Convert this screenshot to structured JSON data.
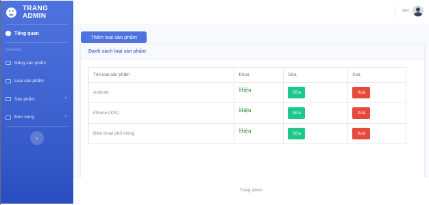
{
  "sidebar": {
    "brand": "TRANG ADMIN",
    "dashboard_label": "Tổng quan",
    "section_heading": "DANH MỤC",
    "items": [
      {
        "label": "Hãng sản phẩm"
      },
      {
        "label": "Loại sản phẩm"
      },
      {
        "label": "Sản phẩm",
        "chevron": "›"
      },
      {
        "label": "Đơn hàng",
        "chevron": "›"
      }
    ],
    "toggle_glyph": "‹"
  },
  "topbar": {
    "user_name": "viet"
  },
  "main": {
    "add_button": "Thêm loại sản phẩm",
    "card_title": "Danh sách loại sản phẩm",
    "table": {
      "headers": [
        "Tên loại sản phẩm",
        "Khoá",
        "Sửa",
        "Xoá"
      ],
      "rows": [
        {
          "name": "Android",
          "status": "Hiện",
          "edit": "Sửa",
          "delete": "Xoá"
        },
        {
          "name": "iPhone (iOS)",
          "status": "Hiện",
          "edit": "Sửa",
          "delete": "Xoá"
        },
        {
          "name": "Điện thoại phổ thông",
          "status": "Hiện",
          "edit": "Sửa",
          "delete": "Xoá"
        }
      ]
    }
  },
  "footer": {
    "text": "Trang admin"
  },
  "colors": {
    "primary": "#4e73df",
    "success": "#1cc88a",
    "danger": "#e74a3b",
    "status_text": "#0b7a1a"
  },
  "icons": {
    "brand": "smile-icon",
    "dashboard": "dashboard-icon",
    "nav": "table-icon",
    "user": "user-avatar"
  }
}
